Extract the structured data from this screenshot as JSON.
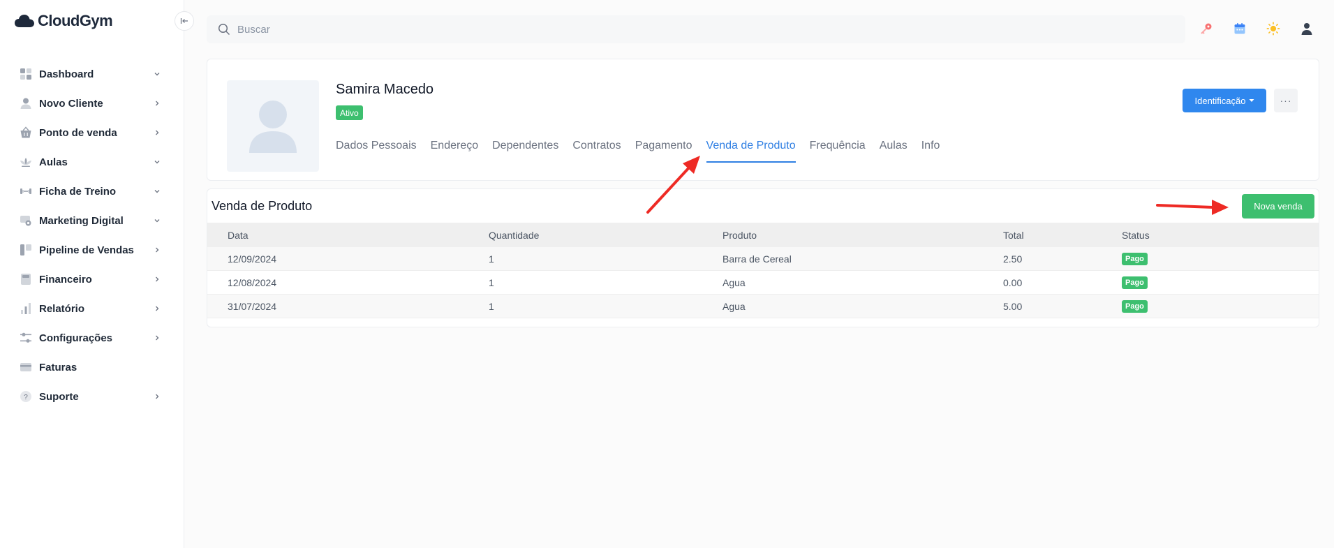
{
  "app": {
    "name": "CloudGym"
  },
  "sidebar": {
    "items": [
      {
        "label": "Dashboard",
        "icon": "dashboard-icon",
        "chevron": "down"
      },
      {
        "label": "Novo Cliente",
        "icon": "user-icon",
        "chevron": "right"
      },
      {
        "label": "Ponto de venda",
        "icon": "basket-icon",
        "chevron": "right"
      },
      {
        "label": "Aulas",
        "icon": "lotus-icon",
        "chevron": "down"
      },
      {
        "label": "Ficha de Treino",
        "icon": "dumbbell-icon",
        "chevron": "down"
      },
      {
        "label": "Marketing Digital",
        "icon": "megaphone-icon",
        "chevron": "down"
      },
      {
        "label": "Pipeline de Vendas",
        "icon": "pipeline-icon",
        "chevron": "right"
      },
      {
        "label": "Financeiro",
        "icon": "calculator-icon",
        "chevron": "right"
      },
      {
        "label": "Relatório",
        "icon": "bar-chart-icon",
        "chevron": "right"
      },
      {
        "label": "Configurações",
        "icon": "sliders-icon",
        "chevron": "right"
      },
      {
        "label": "Faturas",
        "icon": "card-icon",
        "chevron": ""
      },
      {
        "label": "Suporte",
        "icon": "help-icon",
        "chevron": "right"
      }
    ]
  },
  "search": {
    "placeholder": "Buscar"
  },
  "client": {
    "name": "Samira Macedo",
    "status": "Ativo",
    "identification_label": "Identificação",
    "more_label": "···"
  },
  "tabs": [
    {
      "label": "Dados Pessoais",
      "active": false
    },
    {
      "label": "Endereço",
      "active": false
    },
    {
      "label": "Dependentes",
      "active": false
    },
    {
      "label": "Contratos",
      "active": false
    },
    {
      "label": "Pagamento",
      "active": false
    },
    {
      "label": "Venda de Produto",
      "active": true
    },
    {
      "label": "Frequência",
      "active": false
    },
    {
      "label": "Aulas",
      "active": false
    },
    {
      "label": "Info",
      "active": false
    }
  ],
  "sales": {
    "title": "Venda de Produto",
    "new_sale_label": "Nova venda",
    "columns": [
      "Data",
      "Quantidade",
      "Produto",
      "Total",
      "Status"
    ],
    "rows": [
      {
        "date": "12/09/2024",
        "qty": "1",
        "product": "Barra de Cereal",
        "total": "2.50",
        "status": "Pago"
      },
      {
        "date": "12/08/2024",
        "qty": "1",
        "product": "Agua",
        "total": "0.00",
        "status": "Pago"
      },
      {
        "date": "31/07/2024",
        "qty": "1",
        "product": "Agua",
        "total": "5.00",
        "status": "Pago"
      }
    ]
  },
  "colors": {
    "primary": "#2f87ee",
    "success": "#3dbf6f",
    "annotation": "#ee2a24"
  }
}
